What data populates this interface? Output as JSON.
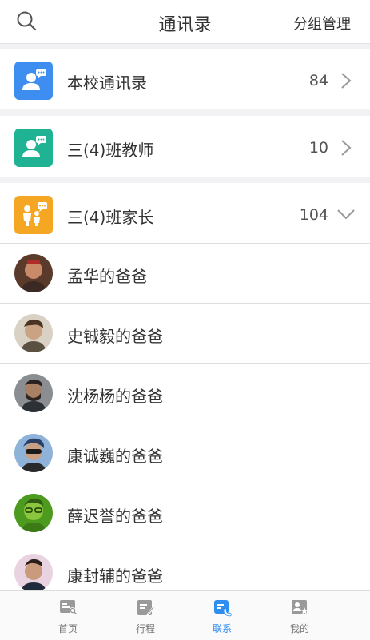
{
  "header": {
    "title": "通讯录",
    "manage_label": "分组管理",
    "search_icon": "search-icon"
  },
  "groups": [
    {
      "name": "本校通讯录",
      "count": "84",
      "icon": "contacts-icon",
      "color": "#3d8ef0",
      "expanded": false
    },
    {
      "name": "三(4)班教师",
      "count": "10",
      "icon": "contacts-icon",
      "color": "#1fb394",
      "expanded": false
    },
    {
      "name": "三(4)班家长",
      "count": "104",
      "icon": "family-icon",
      "color": "#f5a623",
      "expanded": true
    }
  ],
  "members": [
    {
      "name": "孟华的爸爸"
    },
    {
      "name": "史铖毅的爸爸"
    },
    {
      "name": "沈杨杨的爸爸"
    },
    {
      "name": "康诚巍的爸爸"
    },
    {
      "name": "薛迟誉的爸爸"
    },
    {
      "name": "康封辅的爸爸"
    }
  ],
  "tabs": [
    {
      "label": "首页",
      "icon": "home-icon",
      "active": false
    },
    {
      "label": "行程",
      "icon": "schedule-icon",
      "active": false
    },
    {
      "label": "联系",
      "icon": "contact-icon",
      "active": true
    },
    {
      "label": "我的",
      "icon": "profile-icon",
      "active": false
    }
  ],
  "colors": {
    "accent": "#2f8ff1",
    "inactive_tab": "#9a9a9a"
  }
}
